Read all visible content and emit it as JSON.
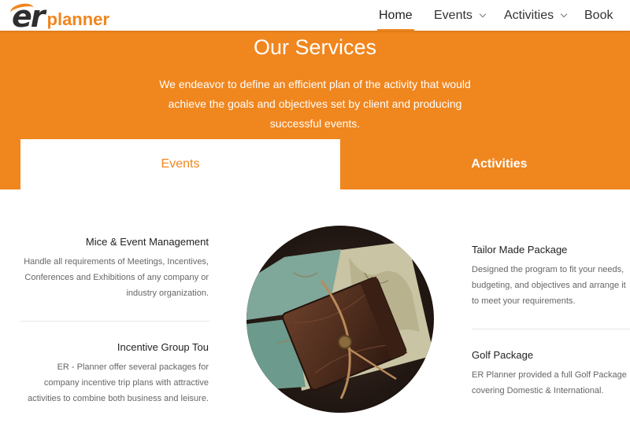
{
  "brand": {
    "logo_mark": "er",
    "logo_word": "planner",
    "accent": "#f0861e"
  },
  "nav": {
    "items": [
      {
        "label": "Home",
        "active": true,
        "dropdown": false
      },
      {
        "label": "Events",
        "active": false,
        "dropdown": true
      },
      {
        "label": "Activities",
        "active": false,
        "dropdown": true
      },
      {
        "label": "Book",
        "active": false,
        "dropdown": false
      }
    ]
  },
  "hero": {
    "title": "Our Services",
    "subtitle": "We endeavor to define an efficient plan of the activity that would achieve the goals and objectives set by client and producing successful events."
  },
  "tabs": [
    {
      "label": "Events",
      "active": true
    },
    {
      "label": "Activities",
      "active": false
    }
  ],
  "services_left": [
    {
      "title": "Mice & Event Management",
      "desc": "Handle all requirements of Meetings, Incentives, Conferences and Exhibitions of any company or industry organization."
    },
    {
      "title": "Incentive Group Tou",
      "desc": "ER - Planner offer several packages for company incentive trip plans with attractive activities to combine both business and leisure."
    }
  ],
  "services_right": [
    {
      "title": "Tailor Made Package",
      "desc": "Designed the program to fit your needs, budgeting, and objectives and arrange it to meet your requirements."
    },
    {
      "title": "Golf Package",
      "desc": "ER Planner provided a full Golf Package covering Domestic & International."
    }
  ],
  "photo": {
    "icon": "leather-journal-on-map-image"
  }
}
